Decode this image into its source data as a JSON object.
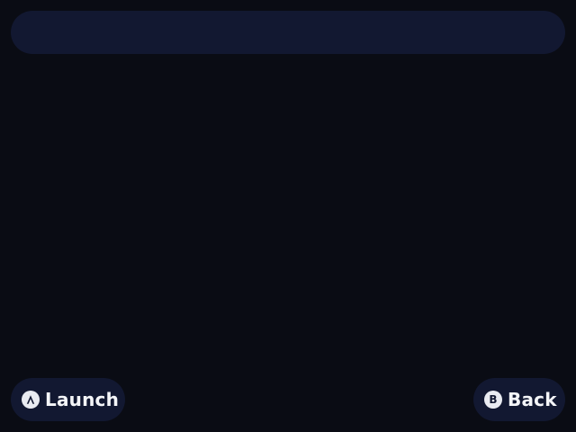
{
  "header": {
    "search": ""
  },
  "footer": {
    "primary": {
      "glyph": "A",
      "label": "Launch",
      "icon": "a-button-icon"
    },
    "secondary": {
      "glyph": "B",
      "label": "Back",
      "icon": "b-button-icon"
    }
  },
  "colors": {
    "background": "#0a0c14",
    "surface": "#121831",
    "text": "#f4f5f8"
  }
}
